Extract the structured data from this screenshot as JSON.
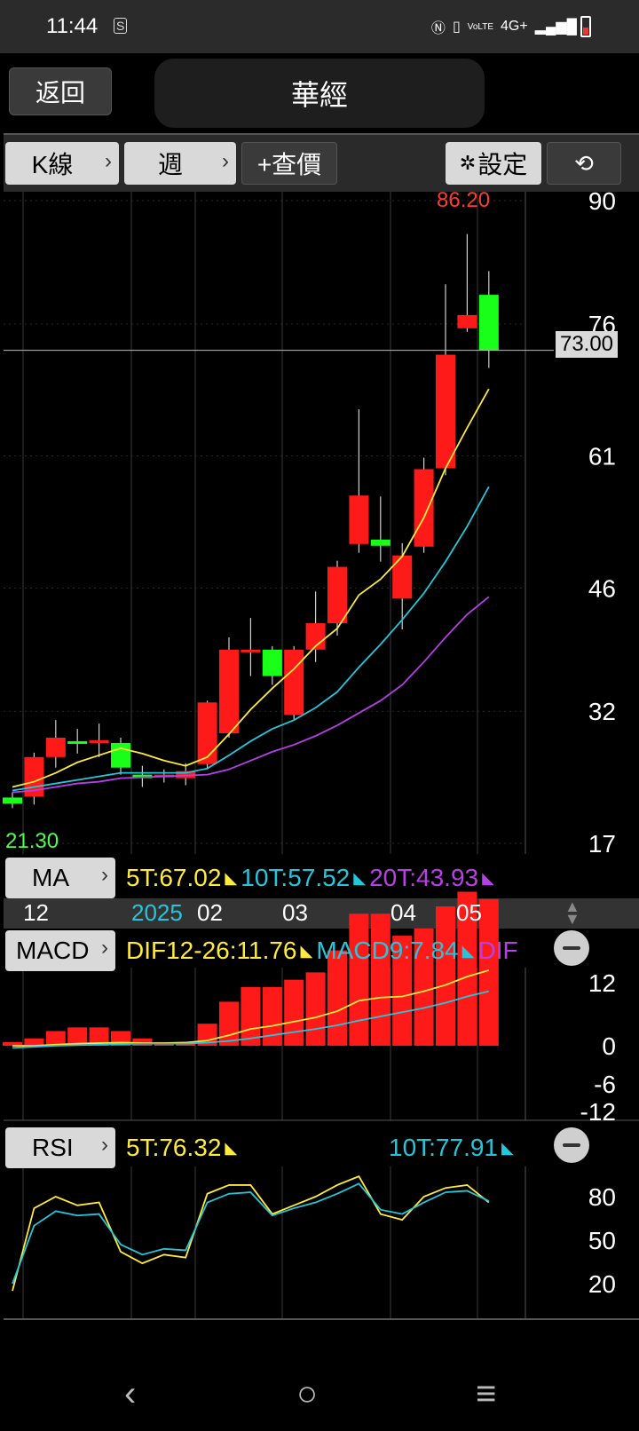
{
  "status": {
    "time": "11:44",
    "sim_badge": "S",
    "network": "4G+",
    "volte": "VoLTE"
  },
  "header": {
    "back_label": "返回",
    "title": "華經"
  },
  "toolbar": {
    "kline_label": "K線",
    "period_label": "週",
    "query_label": "+查價",
    "settings_label": "設定"
  },
  "chart_data": {
    "type": "candlestick",
    "price_axis_ticks": [
      "90",
      "76",
      "61",
      "46",
      "32",
      "17"
    ],
    "price_ticks_values": [
      90,
      76,
      61,
      46,
      32,
      17
    ],
    "high_label": "86.20",
    "low_label": "21.30",
    "current_price": "73.00",
    "current_price_value": 73.0,
    "time_labels": [
      "12",
      "2025",
      "02",
      "03",
      "04",
      "05"
    ],
    "candles": [
      {
        "o": 22.2,
        "c": 21.5,
        "h": 22.8,
        "l": 21.0
      },
      {
        "o": 22.3,
        "c": 26.8,
        "h": 27.3,
        "l": 21.4
      },
      {
        "o": 26.8,
        "c": 29.0,
        "h": 31.0,
        "l": 25.6
      },
      {
        "o": 28.6,
        "c": 28.4,
        "h": 30.0,
        "l": 27.2
      },
      {
        "o": 28.4,
        "c": 28.7,
        "h": 30.6,
        "l": 26.8
      },
      {
        "o": 28.4,
        "c": 25.6,
        "h": 29.0,
        "l": 24.8
      },
      {
        "o": 24.8,
        "c": 24.4,
        "h": 25.8,
        "l": 23.4
      },
      {
        "o": 24.6,
        "c": 24.8,
        "h": 25.4,
        "l": 23.9
      },
      {
        "o": 24.4,
        "c": 25.2,
        "h": 26.1,
        "l": 23.6
      },
      {
        "o": 26.0,
        "c": 33.0,
        "h": 33.2,
        "l": 25.4
      },
      {
        "o": 29.5,
        "c": 39.0,
        "h": 40.4,
        "l": 29.0
      },
      {
        "o": 38.7,
        "c": 39.0,
        "h": 42.6,
        "l": 36.0
      },
      {
        "o": 39.0,
        "c": 36.0,
        "h": 39.4,
        "l": 35.0
      },
      {
        "o": 31.6,
        "c": 39.0,
        "h": 39.4,
        "l": 31.0
      },
      {
        "o": 39.0,
        "c": 42.0,
        "h": 45.6,
        "l": 37.6
      },
      {
        "o": 42.0,
        "c": 48.4,
        "h": 49.1,
        "l": 40.6
      },
      {
        "o": 51.0,
        "c": 56.5,
        "h": 66.3,
        "l": 50.0
      },
      {
        "o": 51.5,
        "c": 50.8,
        "h": 56.4,
        "l": 49.0
      },
      {
        "o": 44.8,
        "c": 49.7,
        "h": 51.1,
        "l": 41.3
      },
      {
        "o": 50.7,
        "c": 59.5,
        "h": 60.8,
        "l": 50.0
      },
      {
        "o": 59.6,
        "c": 72.5,
        "h": 80.5,
        "l": 58.8
      },
      {
        "o": 75.5,
        "c": 77.0,
        "h": 86.2,
        "l": 75.1
      },
      {
        "o": 79.3,
        "c": 73.0,
        "h": 82.0,
        "l": 71.0
      }
    ],
    "ma_lines": [
      {
        "name": "5T",
        "color": "#ffeb3b",
        "values": [
          23.4,
          24.0,
          25.0,
          26.2,
          27.0,
          27.8,
          27.2,
          26.4,
          25.8,
          26.8,
          29.4,
          32.2,
          34.6,
          36.8,
          39.4,
          41.4,
          45.2,
          47.0,
          49.6,
          54.0,
          59.6,
          64.2,
          68.6
        ]
      },
      {
        "name": "10T",
        "color": "#26c6da",
        "values": [
          23.0,
          23.4,
          23.8,
          24.2,
          24.6,
          25.0,
          25.0,
          25.0,
          25.0,
          25.5,
          27.0,
          28.6,
          30.0,
          31.0,
          32.4,
          34.2,
          37.0,
          39.6,
          42.4,
          45.4,
          49.0,
          53.0,
          57.5
        ]
      },
      {
        "name": "20T",
        "color": "#b640e6",
        "values": [
          22.8,
          23.0,
          23.4,
          23.8,
          24.0,
          24.4,
          24.5,
          24.6,
          24.7,
          24.8,
          25.4,
          26.4,
          27.4,
          28.2,
          29.2,
          30.4,
          31.8,
          33.2,
          35.0,
          37.6,
          40.4,
          43.0,
          45.0
        ]
      }
    ]
  },
  "ma_row": {
    "label": "MA",
    "t5": "5T:67.02",
    "t10": "10T:57.52",
    "t20": "20T:43.93"
  },
  "macd_row": {
    "label": "MACD",
    "dif": "DIF12-26:11.76",
    "macd9": "MACD9:7.84",
    "extra": "DIF",
    "ticks": [
      "12",
      "0",
      "-6",
      "-12"
    ],
    "dif_values": [
      0.0,
      0.0,
      0.2,
      0.4,
      0.5,
      0.6,
      0.5,
      0.5,
      0.6,
      1.0,
      2.0,
      3.2,
      3.8,
      4.6,
      5.4,
      6.6,
      8.6,
      9.2,
      9.4,
      10.4,
      11.6,
      13.2,
      14.4
    ],
    "signal_values": [
      -0.4,
      -0.2,
      0.0,
      0.1,
      0.2,
      0.3,
      0.4,
      0.4,
      0.4,
      0.6,
      0.9,
      1.4,
      2.0,
      2.6,
      3.2,
      3.9,
      4.8,
      5.6,
      6.4,
      7.2,
      8.2,
      9.4,
      10.4
    ],
    "histogram": [
      0.1,
      0.2,
      0.4,
      0.5,
      0.5,
      0.4,
      0.2,
      0.1,
      0.1,
      0.6,
      1.2,
      1.6,
      1.6,
      1.8,
      2.0,
      2.6,
      3.6,
      3.6,
      3.0,
      3.2,
      3.8,
      4.2,
      4.0
    ]
  },
  "time_axis": [
    "12",
    "2025",
    "02",
    "03",
    "04",
    "05"
  ],
  "rsi_row": {
    "label": "RSI",
    "t5": "5T:76.32",
    "t10": "10T:77.91",
    "ticks": [
      "80",
      "50",
      "20"
    ],
    "rsi5": [
      15,
      72,
      80,
      74,
      76,
      42,
      34,
      40,
      38,
      82,
      88,
      88,
      68,
      74,
      80,
      88,
      94,
      68,
      64,
      80,
      86,
      88,
      76
    ],
    "rsi10": [
      20,
      60,
      70,
      67,
      68,
      47,
      40,
      44,
      43,
      76,
      82,
      83,
      67,
      72,
      76,
      82,
      89,
      71,
      68,
      76,
      83,
      84,
      77
    ]
  },
  "navbar": {
    "back": "‹",
    "home": "○",
    "menu": "≡"
  }
}
